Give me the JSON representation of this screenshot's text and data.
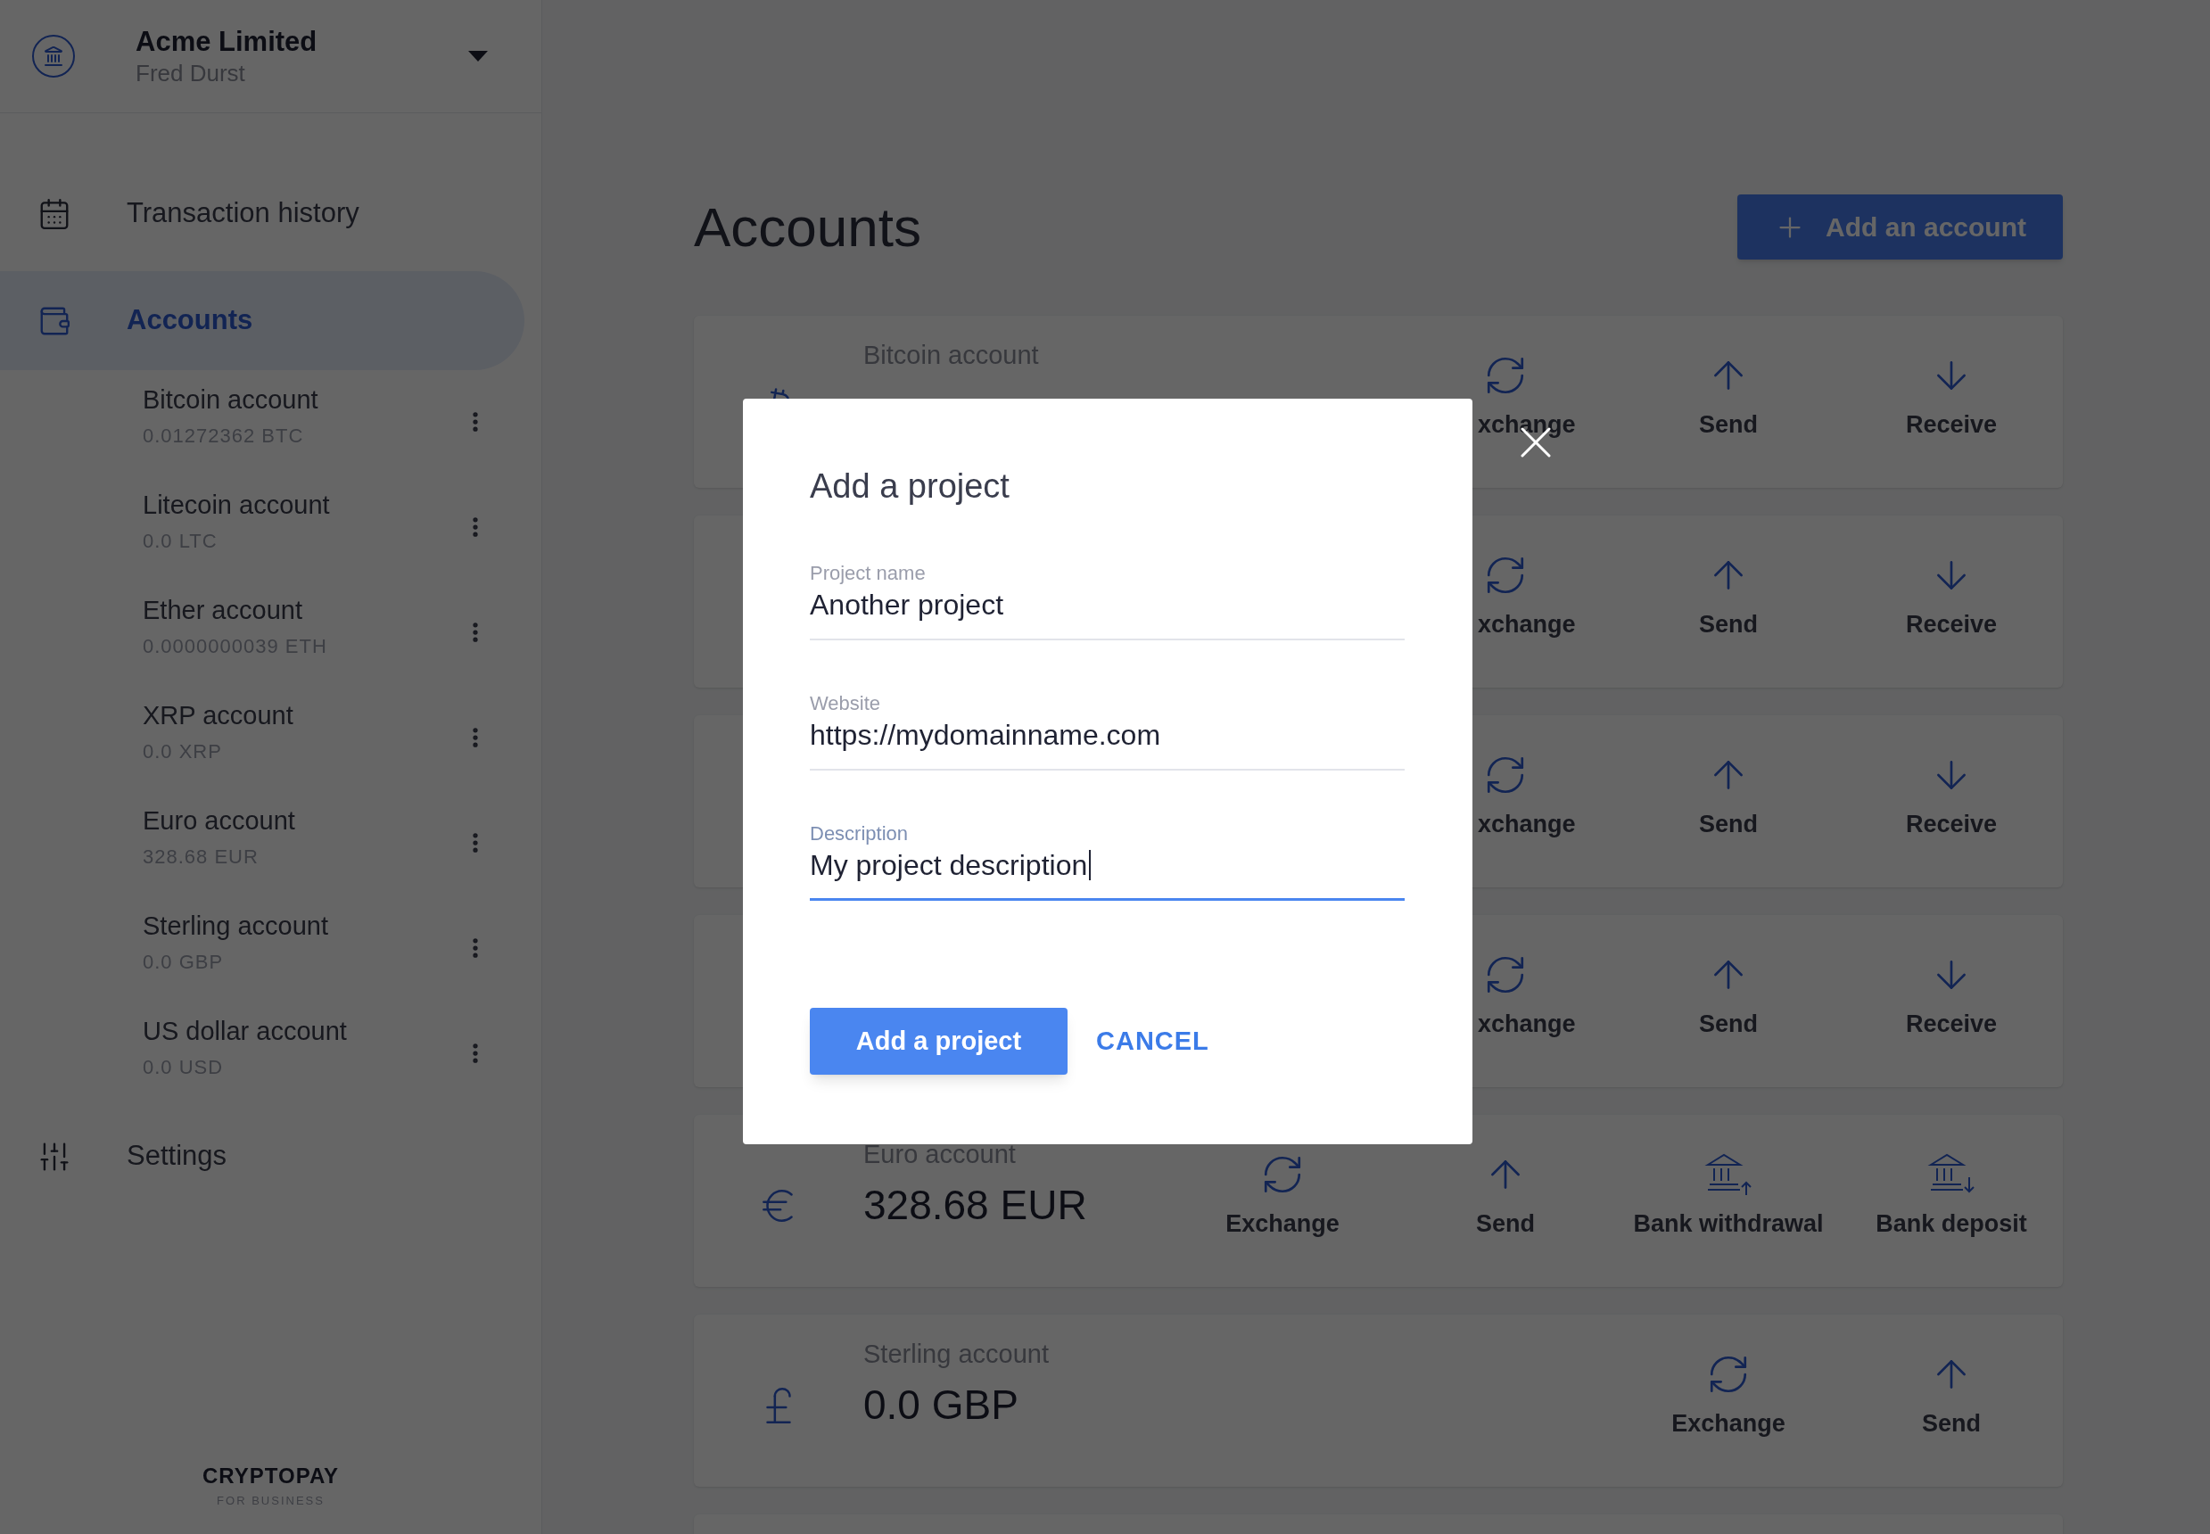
{
  "org": {
    "name": "Acme Limited",
    "user": "Fred Durst"
  },
  "nav": [
    {
      "label": "Transaction history",
      "kind": "calendar",
      "selected": false
    },
    {
      "label": "Accounts",
      "kind": "wallet",
      "selected": true,
      "children": [
        {
          "name": "Bitcoin account",
          "amount": "0.01272362 BTC"
        },
        {
          "name": "Litecoin account",
          "amount": "0.0 LTC"
        },
        {
          "name": "Ether account",
          "amount": "0.0000000039 ETH"
        },
        {
          "name": "XRP account",
          "amount": "0.0 XRP"
        },
        {
          "name": "Euro account",
          "amount": "328.68 EUR"
        },
        {
          "name": "Sterling account",
          "amount": "0.0 GBP"
        },
        {
          "name": "US dollar account",
          "amount": "0.0 USD"
        }
      ]
    },
    {
      "label": "Settings",
      "kind": "sliders",
      "selected": false
    }
  ],
  "brand": {
    "name": "CRYPTOPAY",
    "tagline": "FOR BUSINESS"
  },
  "page": {
    "title": "Accounts",
    "add_button": "Add an account"
  },
  "accounts": [
    {
      "label": "Bitcoin account",
      "kind": "bitcoin",
      "actions": [
        {
          "kind": "exchange",
          "label": "xchange",
          "cut": true
        },
        {
          "kind": "send",
          "label": "Send"
        },
        {
          "kind": "receive",
          "label": "Receive"
        }
      ]
    },
    {
      "actions": [
        {
          "kind": "exchange",
          "label": "xchange",
          "cut": true
        },
        {
          "kind": "send",
          "label": "Send"
        },
        {
          "kind": "receive",
          "label": "Receive"
        }
      ]
    },
    {
      "actions": [
        {
          "kind": "exchange",
          "label": "xchange",
          "cut": true
        },
        {
          "kind": "send",
          "label": "Send"
        },
        {
          "kind": "receive",
          "label": "Receive"
        }
      ]
    },
    {
      "actions": [
        {
          "kind": "exchange",
          "label": "xchange",
          "cut": true
        },
        {
          "kind": "send",
          "label": "Send"
        },
        {
          "kind": "receive",
          "label": "Receive"
        }
      ]
    },
    {
      "label": "Euro account",
      "amount": "328.68 EUR",
      "kind": "euro",
      "actions": [
        {
          "kind": "exchange",
          "label": "Exchange"
        },
        {
          "kind": "send",
          "label": "Send"
        },
        {
          "kind": "withdrawal",
          "label": "Bank withdrawal"
        },
        {
          "kind": "deposit",
          "label": "Bank deposit"
        }
      ]
    },
    {
      "label": "Sterling account",
      "amount": "0.0 GBP",
      "kind": "pound",
      "actions": [
        {
          "kind": "exchange",
          "label": "Exchange"
        },
        {
          "kind": "send",
          "label": "Send"
        }
      ]
    }
  ],
  "modal": {
    "title": "Add a project",
    "fields": [
      {
        "label": "Project name",
        "value": "Another project",
        "focused": false
      },
      {
        "label": "Website",
        "value": "https://mydomainname.com",
        "focused": false
      },
      {
        "label": "Description",
        "value": "My project description",
        "focused": true
      }
    ],
    "submit": "Add a project",
    "cancel": "CANCEL"
  }
}
